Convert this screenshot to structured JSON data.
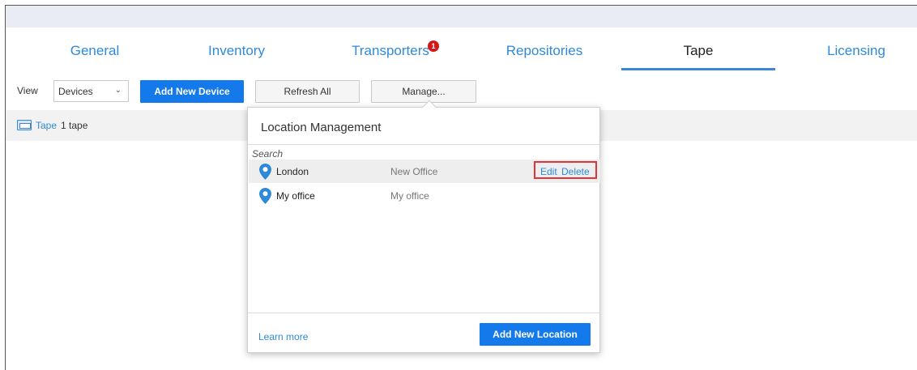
{
  "tabs": [
    {
      "label": "General"
    },
    {
      "label": "Inventory"
    },
    {
      "label": "Transporters",
      "badge": "1"
    },
    {
      "label": "Repositories"
    },
    {
      "label": "Tape",
      "active": true
    },
    {
      "label": "Licensing"
    }
  ],
  "toolbar": {
    "view_label": "View",
    "view_select_value": "Devices",
    "add_device_label": "Add New Device",
    "refresh_label": "Refresh All",
    "manage_label": "Manage..."
  },
  "tree": {
    "item_label": "Tape",
    "item_count": "1 tape"
  },
  "popup": {
    "title": "Location Management",
    "search_placeholder": "Search",
    "locations": [
      {
        "name": "London",
        "description": "New Office",
        "edit": "Edit",
        "delete": "Delete"
      },
      {
        "name": "My office",
        "description": "My office"
      }
    ],
    "learn_more": "Learn more",
    "add_location_label": "Add New Location"
  },
  "colors": {
    "accent": "#1479ea",
    "link": "#2e8ad8",
    "badge": "#d01919",
    "highlight_border": "#e0333a"
  }
}
